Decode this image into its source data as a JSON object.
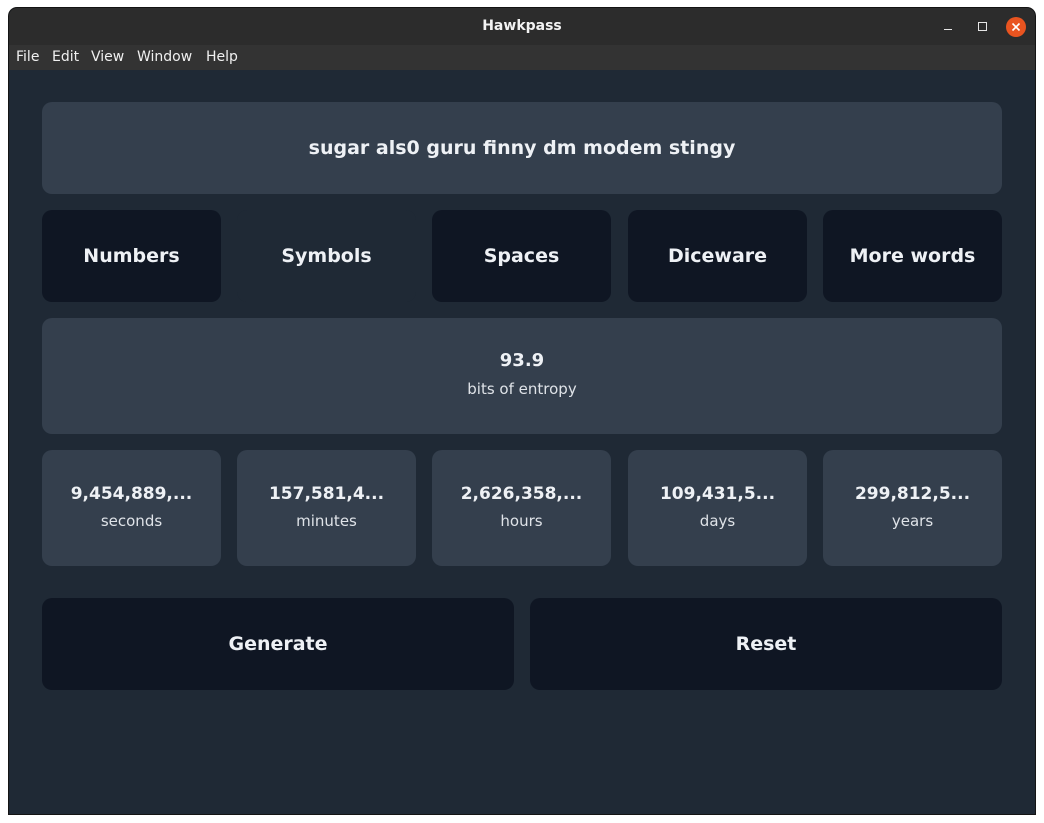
{
  "window": {
    "title": "Hawkpass"
  },
  "menu": [
    "File",
    "Edit",
    "View",
    "Window",
    "Help"
  ],
  "password": "sugar als0 guru finny dm modem stingy",
  "toggles": [
    {
      "label": "Numbers",
      "active": true
    },
    {
      "label": "Symbols",
      "active": false
    },
    {
      "label": "Spaces",
      "active": true
    },
    {
      "label": "Diceware",
      "active": true
    },
    {
      "label": "More words",
      "active": true
    }
  ],
  "entropy": {
    "value": "93.9",
    "label": "bits of entropy"
  },
  "crack_time": [
    {
      "value": "9,454,889,...",
      "unit": "seconds"
    },
    {
      "value": "157,581,4...",
      "unit": "minutes"
    },
    {
      "value": "2,626,358,...",
      "unit": "hours"
    },
    {
      "value": "109,431,5...",
      "unit": "days"
    },
    {
      "value": "299,812,5...",
      "unit": "years"
    }
  ],
  "actions": {
    "generate": "Generate",
    "reset": "Reset"
  },
  "colors": {
    "background": "#1f2935",
    "card": "#343f4d",
    "button_dark": "#0f1623",
    "close_button": "#e95420"
  }
}
